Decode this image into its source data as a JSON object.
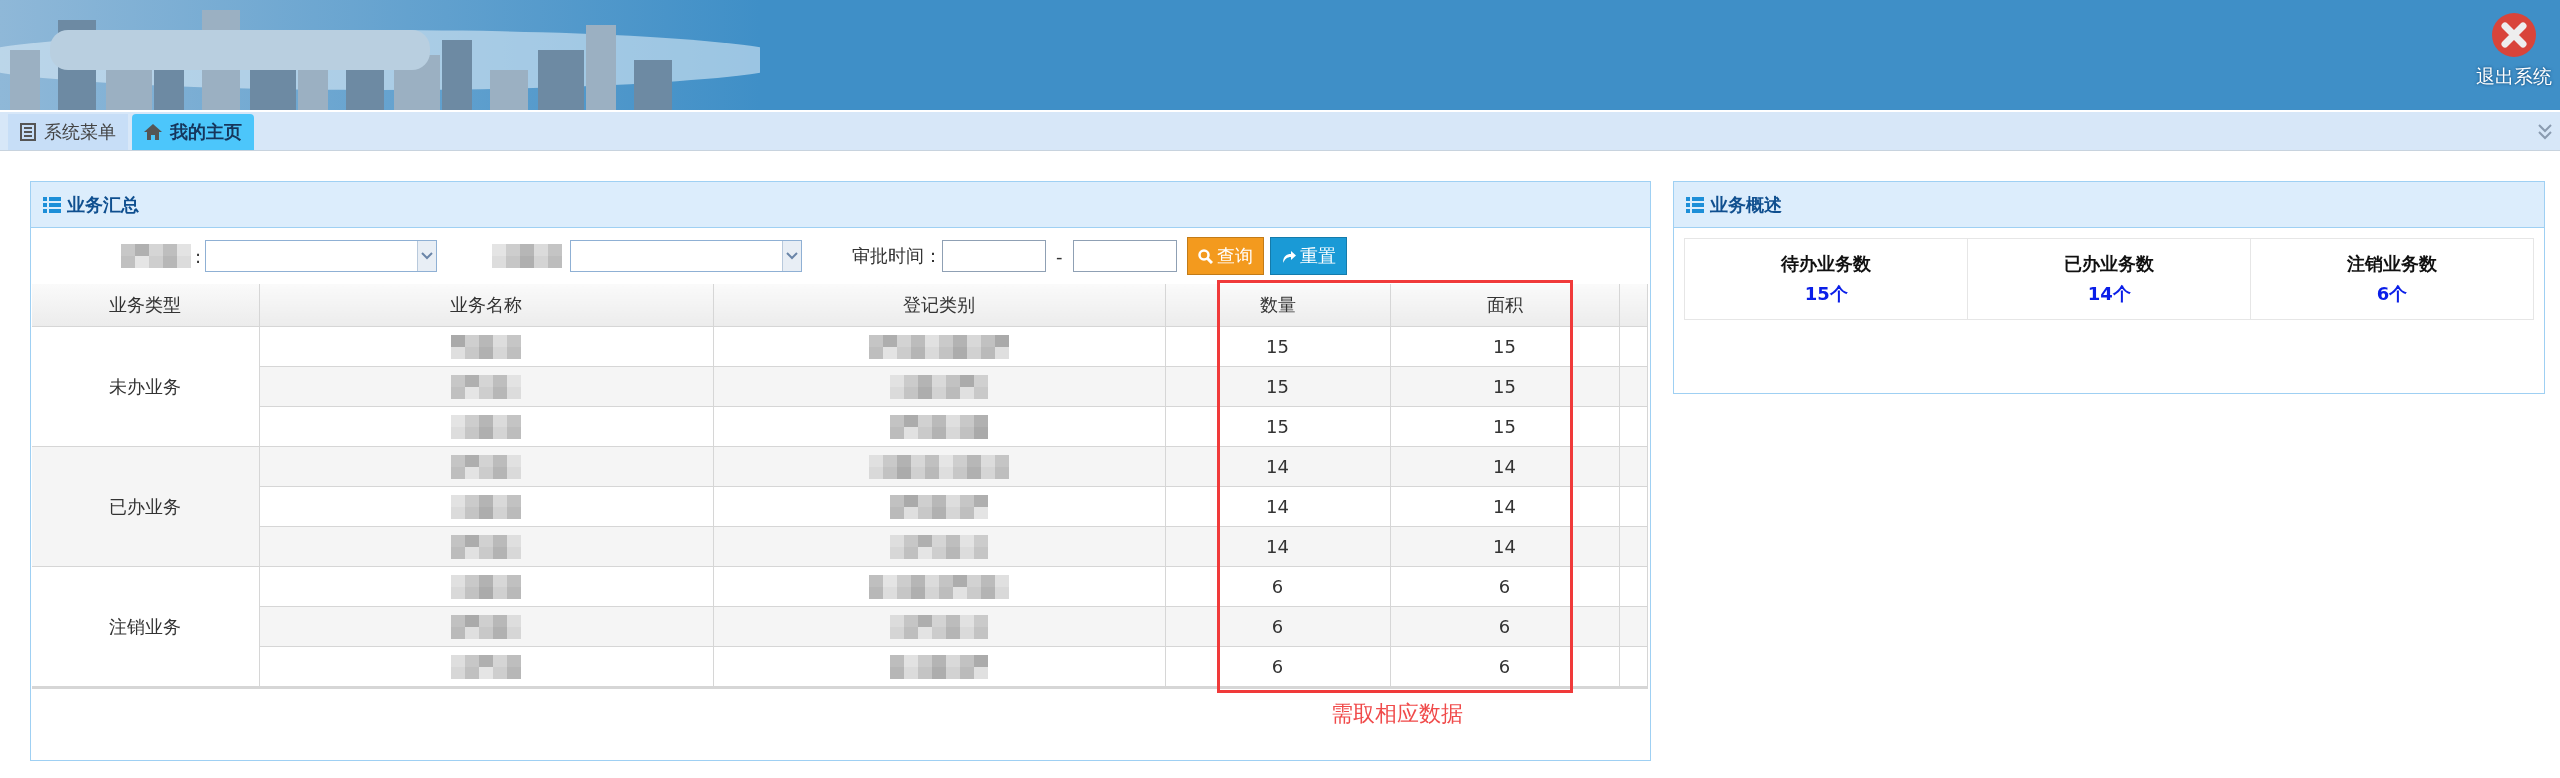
{
  "header": {
    "exit_label": "退出系统"
  },
  "tabs": [
    {
      "label": "系统菜单",
      "selected": false,
      "kind": "menu"
    },
    {
      "label": "我的主页",
      "selected": true,
      "kind": "home"
    }
  ],
  "summary_panel": {
    "title": "业务汇总",
    "filter": {
      "separator_1": ":",
      "date_label": "审批时间：",
      "range_separator": "-",
      "buttons": [
        {
          "label": "查询",
          "kind": "search"
        },
        {
          "label": "重置",
          "kind": "reset"
        }
      ]
    },
    "table": {
      "columns": [
        "业务类型",
        "业务名称",
        "登记类别",
        "数量",
        "面积"
      ],
      "groups": [
        {
          "type": "未办业务",
          "rows": [
            {
              "quantity": "15",
              "area": "15"
            },
            {
              "quantity": "15",
              "area": "15"
            },
            {
              "quantity": "15",
              "area": "15"
            }
          ]
        },
        {
          "type": "已办业务",
          "rows": [
            {
              "quantity": "14",
              "area": "14"
            },
            {
              "quantity": "14",
              "area": "14"
            },
            {
              "quantity": "14",
              "area": "14"
            }
          ]
        },
        {
          "type": "注销业务",
          "rows": [
            {
              "quantity": "6",
              "area": "6"
            },
            {
              "quantity": "6",
              "area": "6"
            },
            {
              "quantity": "6",
              "area": "6"
            }
          ]
        }
      ]
    },
    "annotation": "需取相应数据"
  },
  "overview_panel": {
    "title": "业务概述",
    "stats": [
      {
        "label": "待办业务数",
        "value": "15个"
      },
      {
        "label": "已办业务数",
        "value": "14个"
      },
      {
        "label": "注销业务数",
        "value": "6个"
      }
    ]
  }
}
